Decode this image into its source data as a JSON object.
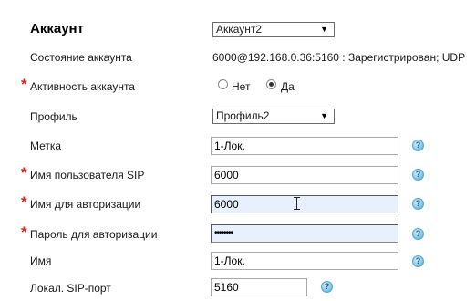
{
  "title": "Аккаунт",
  "account_select": {
    "value": "Аккаунт2"
  },
  "status": {
    "label": "Состояние аккаунта",
    "value": "6000@192.168.0.36:5160 : Зарегистрирован; UDP"
  },
  "activity": {
    "label": "Активность аккаунта",
    "options": [
      "Нет",
      "Да"
    ],
    "selected": "Да"
  },
  "profile": {
    "label": "Профиль",
    "value": "Профиль2"
  },
  "tag": {
    "label": "Метка",
    "value": "1-Лок."
  },
  "sip_user": {
    "label": "Имя пользователя SIP",
    "value": "6000"
  },
  "auth_name": {
    "label": "Имя для авторизации",
    "value": "6000"
  },
  "auth_pass": {
    "label": "Пароль для авторизации",
    "value": "••••••••"
  },
  "name": {
    "label": "Имя",
    "value": "1-Лок."
  },
  "local_port": {
    "label": "Локал. SIP-порт",
    "value": "5160"
  },
  "required_mark": "*",
  "help_glyph": "?",
  "colors": {
    "required": "#d42a22",
    "autofill_bg": "#e8f0fe",
    "help_icon": "#5aa5cf"
  }
}
